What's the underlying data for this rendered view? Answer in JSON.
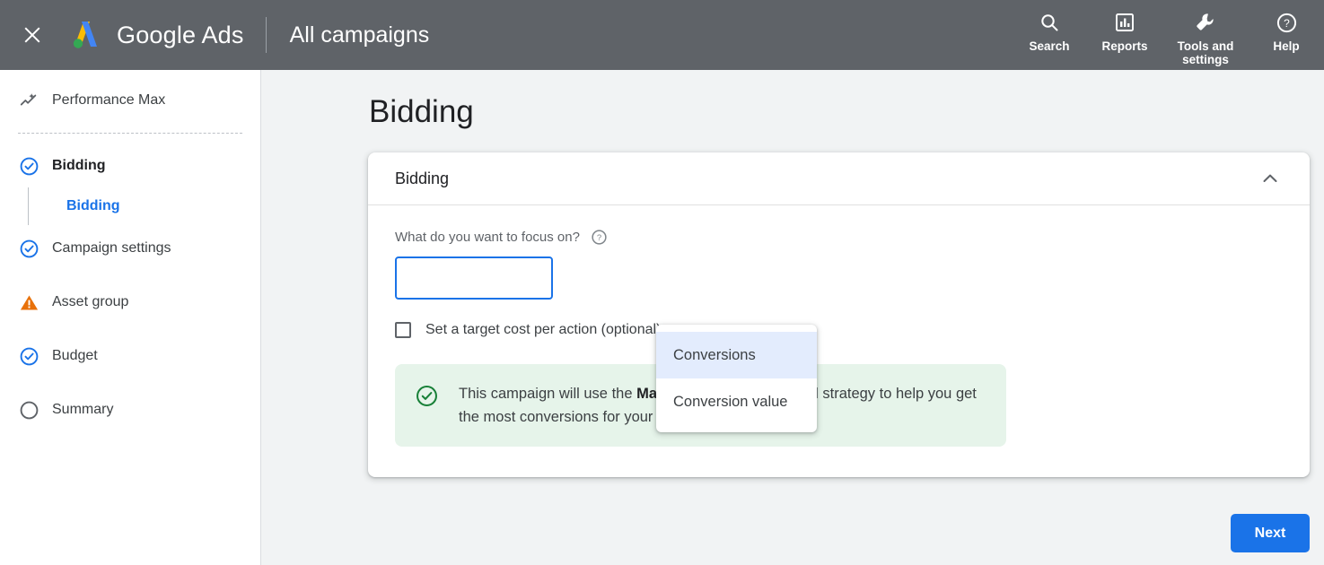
{
  "header": {
    "close_icon": "close-icon",
    "logo_icon": "google-ads-logo",
    "brand": "Google Ads",
    "page_context": "All campaigns",
    "actions": [
      {
        "label": "Search",
        "icon": "search-icon"
      },
      {
        "label": "Reports",
        "icon": "bar-chart-icon"
      },
      {
        "label": "Tools and settings",
        "icon": "wrench-icon"
      },
      {
        "label": "Help",
        "icon": "help-circle-icon"
      }
    ]
  },
  "sidebar": {
    "items": [
      {
        "label": "Performance Max",
        "icon": "insights-trend-icon",
        "state": "plain"
      },
      {
        "label": "Bidding",
        "icon": "check-circle-icon",
        "state": "complete"
      },
      {
        "label": "Campaign settings",
        "icon": "check-circle-icon",
        "state": "complete"
      },
      {
        "label": "Asset group",
        "icon": "warning-triangle-icon",
        "state": "warning"
      },
      {
        "label": "Budget",
        "icon": "check-circle-icon",
        "state": "complete"
      },
      {
        "label": "Summary",
        "icon": "empty-circle-icon",
        "state": "pending"
      }
    ],
    "sub_items": [
      {
        "label": "Bidding",
        "active": true
      }
    ]
  },
  "main": {
    "page_title": "Bidding",
    "card": {
      "title": "Bidding",
      "collapse_icon": "chevron-up-icon",
      "field_label": "What do you want to focus on?",
      "help_icon": "help-circle-icon",
      "select_value": "Conversions",
      "checkbox_label": "Set a target cost per action (optional)",
      "banner": {
        "icon": "check-circle-icon",
        "text_before": "This campaign will use the ",
        "text_bold": "Maximise conversions",
        "text_after": " bid strategy to help you get the most conversions for your budget"
      }
    },
    "dropdown": {
      "options": [
        {
          "label": "Conversions",
          "selected": true
        },
        {
          "label": "Conversion value",
          "selected": false
        }
      ]
    },
    "next_button": "Next"
  },
  "colors": {
    "header_bg": "#5f6368",
    "accent_blue": "#1a73e8",
    "warning_orange": "#e8710a",
    "success_green": "#188038",
    "banner_bg": "#e6f4ea",
    "dropdown_selected_bg": "#e3ecfd",
    "content_bg": "#f1f3f4"
  }
}
